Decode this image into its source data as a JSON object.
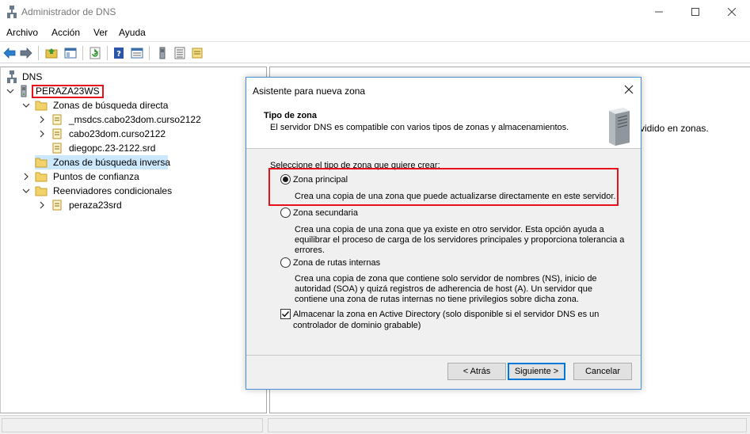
{
  "window": {
    "title": "Administrador de DNS",
    "controls": [
      "minimize-icon",
      "maximize-icon",
      "close-icon"
    ]
  },
  "menu": [
    "Archivo",
    "Acción",
    "Ver",
    "Ayuda"
  ],
  "toolbar": {
    "icons": [
      "back-arrow-icon",
      "forward-arrow-icon",
      "folder-up-icon",
      "show-hide-tree-icon",
      "refresh-icon",
      "help-icon",
      "properties-icon",
      "server-icon",
      "list-icon",
      "notes-icon"
    ]
  },
  "tree": {
    "root": "DNS",
    "server": "PERAZA23WS",
    "forward_zones": "Zonas de búsqueda directa",
    "zone_1": "_msdcs.cabo23dom.curso2122",
    "zone_2": "cabo23dom.curso2122",
    "zone_3": "diegopc.23-2122.srd",
    "reverse_zones": "Zonas de búsqueda inversa",
    "trust_points": "Puntos de confianza",
    "conditional_forwarders": "Reenviadores condicionales",
    "forwarder_1": "peraza23srd"
  },
  "right_pane": {
    "text": "vidido en zonas."
  },
  "dialog": {
    "title": "Asistente para nueva zona",
    "header_title": "Tipo de zona",
    "header_subtitle": "El servidor DNS es compatible con varios tipos de zonas y almacenamientos.",
    "prompt": "Seleccione el tipo de zona que quiere crear:",
    "options": [
      {
        "label": "Zona principal",
        "selected": true,
        "description_lines": [
          "Crea una copia de una zona que puede actualizarse directamente en este servidor."
        ]
      },
      {
        "label": "Zona secundaria",
        "selected": false,
        "description_lines": [
          "Crea una copia de una zona que ya existe en otro servidor. Esta opción ayuda a",
          "equilibrar el proceso de carga de los servidores principales y proporciona tolerancia a",
          "errores."
        ]
      },
      {
        "label": "Zona de rutas internas",
        "selected": false,
        "description_lines": [
          "Crea una copia de zona que contiene solo servidor de nombres (NS), inicio de",
          "autoridad (SOA) y quizá registros de adherencia de host (A). Un servidor que",
          "contiene una zona de rutas internas no tiene privilegios sobre dicha zona."
        ]
      }
    ],
    "ad_checkbox": {
      "checked": true,
      "label_lines": [
        "Almacenar la zona en Active Directory (solo disponible si el servidor DNS es un",
        "controlador de dominio grabable)"
      ]
    },
    "buttons": {
      "back": "< Atrás",
      "next": "Siguiente >",
      "cancel": "Cancelar"
    }
  },
  "colors": {
    "highlight_red": "#e8101b",
    "selection": "#cce8ff",
    "accent_blue": "#0078d7"
  }
}
